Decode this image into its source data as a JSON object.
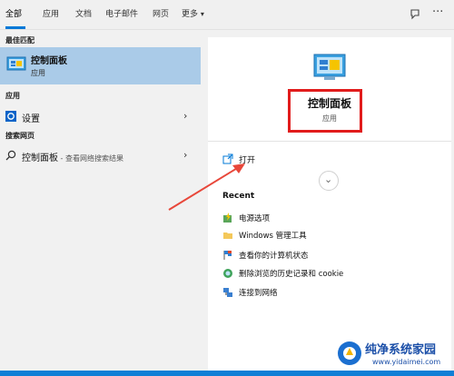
{
  "tabs": [
    {
      "label": "全部"
    },
    {
      "label": "应用"
    },
    {
      "label": "文档"
    },
    {
      "label": "电子邮件"
    },
    {
      "label": "网页"
    },
    {
      "label": "更多"
    }
  ],
  "left": {
    "best_match_heading": "最佳匹配",
    "best_match": {
      "title": "控制面板",
      "subtitle": "应用"
    },
    "apps_heading": "应用",
    "apps": [
      {
        "label": "设置"
      }
    ],
    "web_heading": "搜索网页",
    "web": [
      {
        "label": "控制面板",
        "hint": " - 查看网络搜索结果"
      }
    ]
  },
  "detail": {
    "title": "控制面板",
    "subtitle": "应用",
    "open_label": "打开",
    "recent_heading": "Recent",
    "recent": [
      {
        "label": "电源选项",
        "icon": "power-options-icon"
      },
      {
        "label": "Windows 管理工具",
        "icon": "folder-icon"
      },
      {
        "label": "查看你的计算机状态",
        "icon": "flag-icon"
      },
      {
        "label": "删除浏览的历史记录和 cookie",
        "icon": "internet-options-icon"
      },
      {
        "label": "连接到网络",
        "icon": "network-icon"
      }
    ]
  },
  "watermark": {
    "text": "纯净系统家园",
    "url": "www.yidaimei.com"
  },
  "colors": {
    "accent": "#0078d7",
    "selection": "#aacbe8",
    "highlight": "#e11c1c",
    "arrow": "#e8473a"
  }
}
